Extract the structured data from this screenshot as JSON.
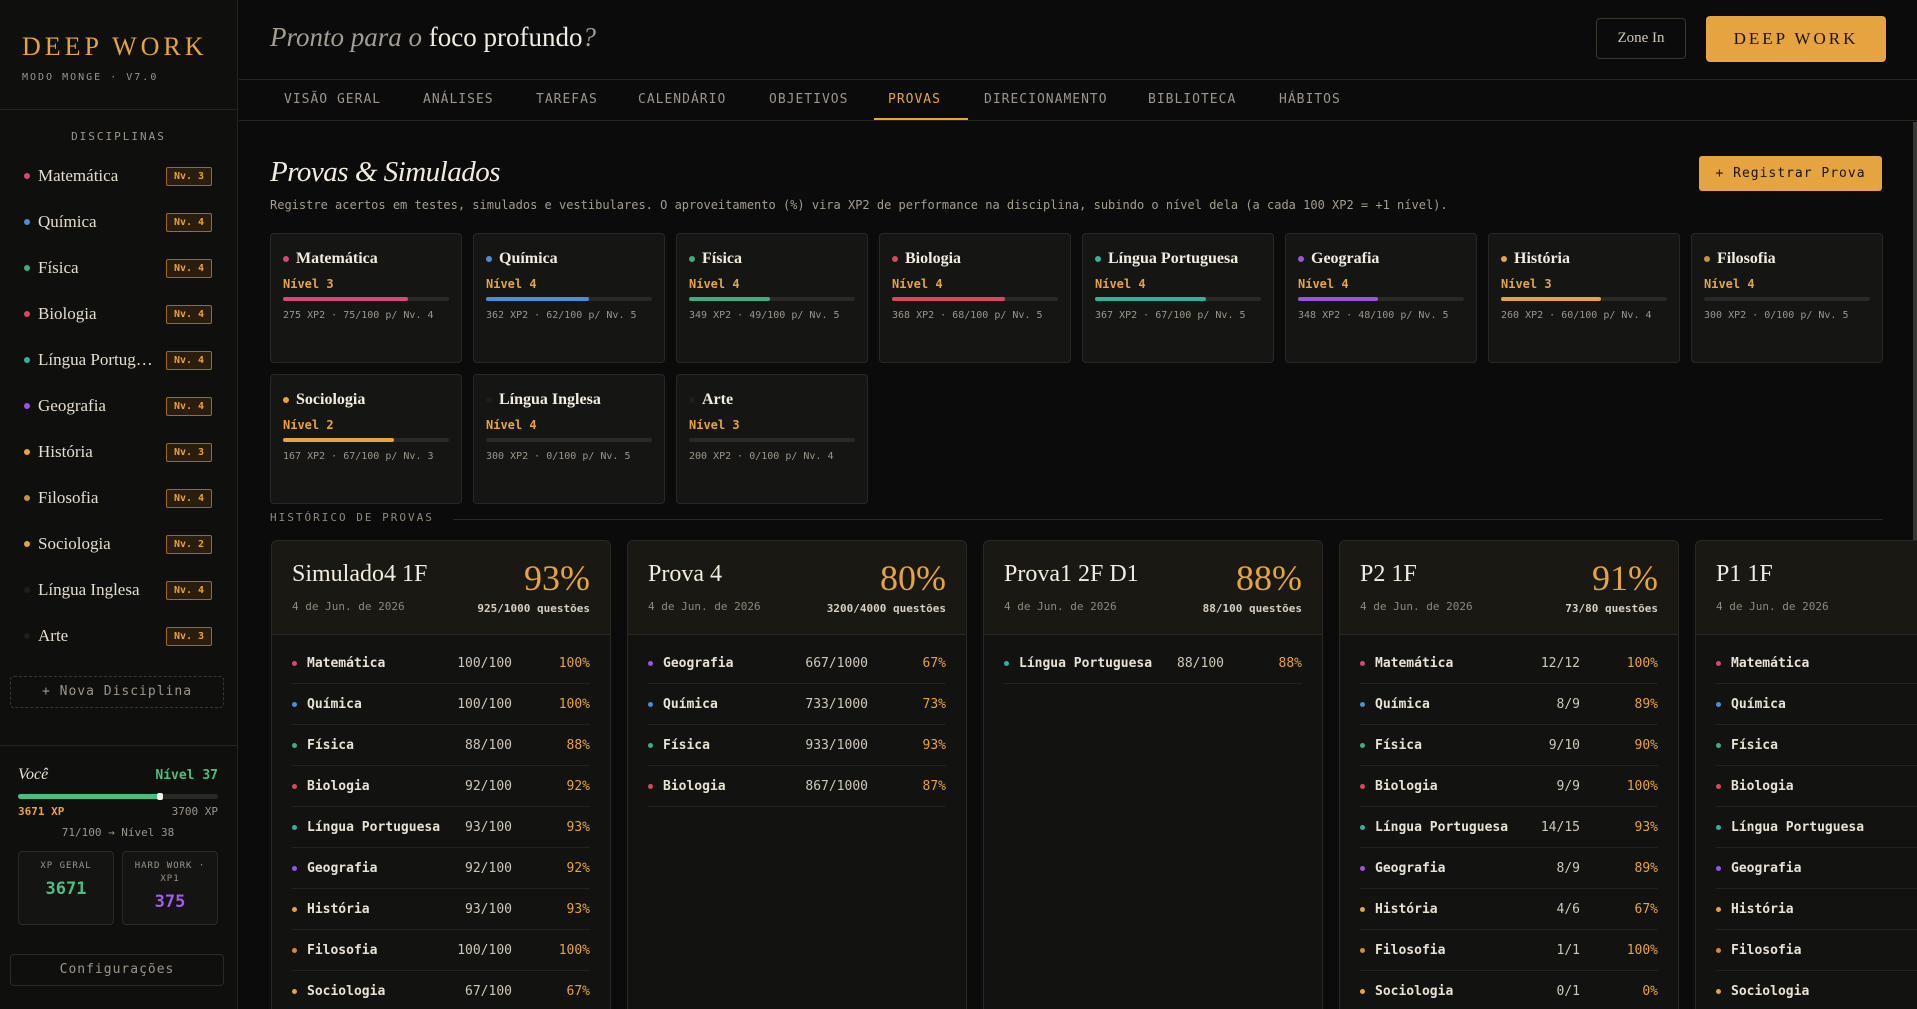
{
  "brand": {
    "title": "DEEP WORK",
    "subtitle": "MODO MONGE · V7.0"
  },
  "sidebar": {
    "heading": "DISCIPLINAS",
    "items": [
      {
        "label": "Matemática",
        "level": "Nv. 3",
        "color": "#d9467a"
      },
      {
        "label": "Química",
        "level": "Nv. 4",
        "color": "#4a8fd6"
      },
      {
        "label": "Física",
        "level": "Nv. 4",
        "color": "#3fae7a"
      },
      {
        "label": "Biologia",
        "level": "Nv. 4",
        "color": "#d9475c"
      },
      {
        "label": "Língua Portuguesa",
        "level": "Nv. 4",
        "color": "#2fb39a"
      },
      {
        "label": "Geografia",
        "level": "Nv. 4",
        "color": "#9a55e0"
      },
      {
        "label": "História",
        "level": "Nv. 3",
        "color": "#e6a440"
      },
      {
        "label": "Filosofia",
        "level": "Nv. 4",
        "color": "#c9903a"
      },
      {
        "label": "Sociologia",
        "level": "Nv. 2",
        "color": "#e6a440"
      },
      {
        "label": "Língua Inglesa",
        "level": "Nv. 4",
        "color": "#1e1e1e"
      },
      {
        "label": "Arte",
        "level": "Nv. 3",
        "color": "#1e1e1e"
      }
    ],
    "new_discipline": "+ Nova Disciplina",
    "settings": "Configurações"
  },
  "user": {
    "you": "Você",
    "level": "Nível 37",
    "xp_current": "3671 XP",
    "xp_max": "3700 XP",
    "xp_progress": 0.71,
    "next_level": "71/100 → Nível 38",
    "stats": [
      {
        "label": "XP GERAL",
        "value": "3671",
        "color": "#4fbf7d"
      },
      {
        "label": "HARD WORK · XP1",
        "value": "375",
        "color": "#a35bf0"
      }
    ]
  },
  "header": {
    "greeting_pre": "Pronto para o ",
    "greeting_bold": "foco profundo",
    "greeting_post": "?",
    "zone_in": "Zone In",
    "deep_work": "DEEP WORK"
  },
  "tabs": [
    "VISÃO GERAL",
    "ANÁLISES",
    "TAREFAS",
    "CALENDÁRIO",
    "OBJETIVOS",
    "PROVAS",
    "DIRECIONAMENTO",
    "BIBLIOTECA",
    "HÁBITOS"
  ],
  "active_tab": "PROVAS",
  "page": {
    "title": "Provas & Simulados",
    "description": "Registre acertos em testes, simulados e vestibulares. O aproveitamento (%) vira XP2 de performance na disciplina, subindo o nível dela (a cada 100 XP2 = +1 nível).",
    "register_button": "+ Registrar Prova",
    "history_heading": "HISTÓRICO DE PROVAS"
  },
  "subjects": [
    {
      "name": "Matemática",
      "level": "Nível 3",
      "progress": 0.75,
      "xp": "275 XP2 · 75/100 p/ Nv. 4",
      "color": "#d9467a"
    },
    {
      "name": "Química",
      "level": "Nível 4",
      "progress": 0.62,
      "xp": "362 XP2 · 62/100 p/ Nv. 5",
      "color": "#4a8fd6"
    },
    {
      "name": "Física",
      "level": "Nível 4",
      "progress": 0.49,
      "xp": "349 XP2 · 49/100 p/ Nv. 5",
      "color": "#3fae7a"
    },
    {
      "name": "Biologia",
      "level": "Nível 4",
      "progress": 0.68,
      "xp": "368 XP2 · 68/100 p/ Nv. 5",
      "color": "#d9475c"
    },
    {
      "name": "Língua Portuguesa",
      "level": "Nível 4",
      "progress": 0.67,
      "xp": "367 XP2 · 67/100 p/ Nv. 5",
      "color": "#2fb39a"
    },
    {
      "name": "Geografia",
      "level": "Nível 4",
      "progress": 0.48,
      "xp": "348 XP2 · 48/100 p/ Nv. 5",
      "color": "#9a55e0"
    },
    {
      "name": "História",
      "level": "Nível 3",
      "progress": 0.6,
      "xp": "260 XP2 · 60/100 p/ Nv. 4",
      "color": "#e6a440"
    },
    {
      "name": "Filosofia",
      "level": "Nível 4",
      "progress": 0.0,
      "xp": "300 XP2 · 0/100 p/ Nv. 5",
      "color": "#c9903a"
    },
    {
      "name": "Sociologia",
      "level": "Nível 2",
      "progress": 0.67,
      "xp": "167 XP2 · 67/100 p/ Nv. 3",
      "color": "#e6a440"
    },
    {
      "name": "Língua Inglesa",
      "level": "Nível 4",
      "progress": 0.0,
      "xp": "300 XP2 · 0/100 p/ Nv. 5",
      "color": "#1e1e1e"
    },
    {
      "name": "Arte",
      "level": "Nível 3",
      "progress": 0.0,
      "xp": "200 XP2 · 0/100 p/ Nv. 4",
      "color": "#1e1e1e"
    }
  ],
  "exams": [
    {
      "title": "Simulado4 1F",
      "date": "4 de Jun. de 2026",
      "pct": "93%",
      "questions": "925/1000 questões",
      "rows": [
        {
          "name": "Matemática",
          "score": "100/100",
          "pct": "100%",
          "color": "#d9467a"
        },
        {
          "name": "Química",
          "score": "100/100",
          "pct": "100%",
          "color": "#4a8fd6"
        },
        {
          "name": "Física",
          "score": "88/100",
          "pct": "88%",
          "color": "#3fae7a"
        },
        {
          "name": "Biologia",
          "score": "92/100",
          "pct": "92%",
          "color": "#d9475c"
        },
        {
          "name": "Língua Portuguesa",
          "score": "93/100",
          "pct": "93%",
          "color": "#2fb39a"
        },
        {
          "name": "Geografia",
          "score": "92/100",
          "pct": "92%",
          "color": "#9a55e0"
        },
        {
          "name": "História",
          "score": "93/100",
          "pct": "93%",
          "color": "#e6a440"
        },
        {
          "name": "Filosofia",
          "score": "100/100",
          "pct": "100%",
          "color": "#c9903a"
        },
        {
          "name": "Sociologia",
          "score": "67/100",
          "pct": "67%",
          "color": "#e6a440"
        }
      ]
    },
    {
      "title": "Prova 4",
      "date": "4 de Jun. de 2026",
      "pct": "80%",
      "questions": "3200/4000 questões",
      "rows": [
        {
          "name": "Geografia",
          "score": "667/1000",
          "pct": "67%",
          "color": "#9a55e0"
        },
        {
          "name": "Química",
          "score": "733/1000",
          "pct": "73%",
          "color": "#4a8fd6"
        },
        {
          "name": "Física",
          "score": "933/1000",
          "pct": "93%",
          "color": "#3fae7a"
        },
        {
          "name": "Biologia",
          "score": "867/1000",
          "pct": "87%",
          "color": "#d9475c"
        }
      ]
    },
    {
      "title": "Prova1 2F D1",
      "date": "4 de Jun. de 2026",
      "pct": "88%",
      "questions": "88/100 questões",
      "rows": [
        {
          "name": "Língua Portuguesa",
          "score": "88/100",
          "pct": "88%",
          "color": "#2fb39a"
        }
      ]
    },
    {
      "title": "P2 1F",
      "date": "4 de Jun. de 2026",
      "pct": "91%",
      "questions": "73/80 questões",
      "rows": [
        {
          "name": "Matemática",
          "score": "12/12",
          "pct": "100%",
          "color": "#d9467a"
        },
        {
          "name": "Química",
          "score": "8/9",
          "pct": "89%",
          "color": "#4a8fd6"
        },
        {
          "name": "Física",
          "score": "9/10",
          "pct": "90%",
          "color": "#3fae7a"
        },
        {
          "name": "Biologia",
          "score": "9/9",
          "pct": "100%",
          "color": "#d9475c"
        },
        {
          "name": "Língua Portuguesa",
          "score": "14/15",
          "pct": "93%",
          "color": "#2fb39a"
        },
        {
          "name": "Geografia",
          "score": "8/9",
          "pct": "89%",
          "color": "#9a55e0"
        },
        {
          "name": "História",
          "score": "4/6",
          "pct": "67%",
          "color": "#e6a440"
        },
        {
          "name": "Filosofia",
          "score": "1/1",
          "pct": "100%",
          "color": "#c9903a"
        },
        {
          "name": "Sociologia",
          "score": "0/1",
          "pct": "0%",
          "color": "#e6a440"
        }
      ]
    },
    {
      "title": "P1 1F",
      "date": "4 de Jun. de 2026",
      "pct": "",
      "questions": "",
      "rows": [
        {
          "name": "Matemática",
          "score": "",
          "pct": "",
          "color": "#d9467a"
        },
        {
          "name": "Química",
          "score": "",
          "pct": "",
          "color": "#4a8fd6"
        },
        {
          "name": "Física",
          "score": "",
          "pct": "",
          "color": "#3fae7a"
        },
        {
          "name": "Biologia",
          "score": "",
          "pct": "",
          "color": "#d9475c"
        },
        {
          "name": "Língua Portuguesa",
          "score": "",
          "pct": "",
          "color": "#2fb39a"
        },
        {
          "name": "Geografia",
          "score": "",
          "pct": "",
          "color": "#9a55e0"
        },
        {
          "name": "História",
          "score": "",
          "pct": "",
          "color": "#e6a440"
        },
        {
          "name": "Filosofia",
          "score": "",
          "pct": "",
          "color": "#c9903a"
        },
        {
          "name": "Sociologia",
          "score": "",
          "pct": "",
          "color": "#e6a440"
        }
      ]
    }
  ]
}
